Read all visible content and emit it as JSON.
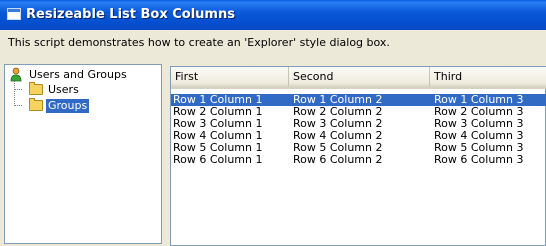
{
  "window": {
    "title": "Resizeable List Box Columns"
  },
  "description": "This script demonstrates how to create an 'Explorer' style dialog box.",
  "tree": {
    "root": "Users and Groups",
    "children": [
      {
        "label": "Users",
        "selected": false
      },
      {
        "label": "Groups",
        "selected": true
      }
    ]
  },
  "listview": {
    "columns": [
      "First",
      "Second",
      "Third"
    ],
    "rows": [
      [
        "Row 1 Column 1",
        "Row 1 Column 2",
        "Row 1 Column 3"
      ],
      [
        "Row 2 Column 1",
        "Row 2 Column 2",
        "Row 2 Column 3"
      ],
      [
        "Row 3 Column 1",
        "Row 3 Column 2",
        "Row 3 Column 3"
      ],
      [
        "Row 4 Column 1",
        "Row 4 Column 2",
        "Row 4 Column 3"
      ],
      [
        "Row 5 Column 1",
        "Row 5 Column 2",
        "Row 5 Column 3"
      ],
      [
        "Row 6 Column 1",
        "Row 6 Column 2",
        "Row 6 Column 3"
      ]
    ],
    "selected_row": 0
  },
  "colors": {
    "selection": "#316ac5",
    "titlebar": "#0b59d8",
    "dialog_bg": "#ece9d8"
  }
}
